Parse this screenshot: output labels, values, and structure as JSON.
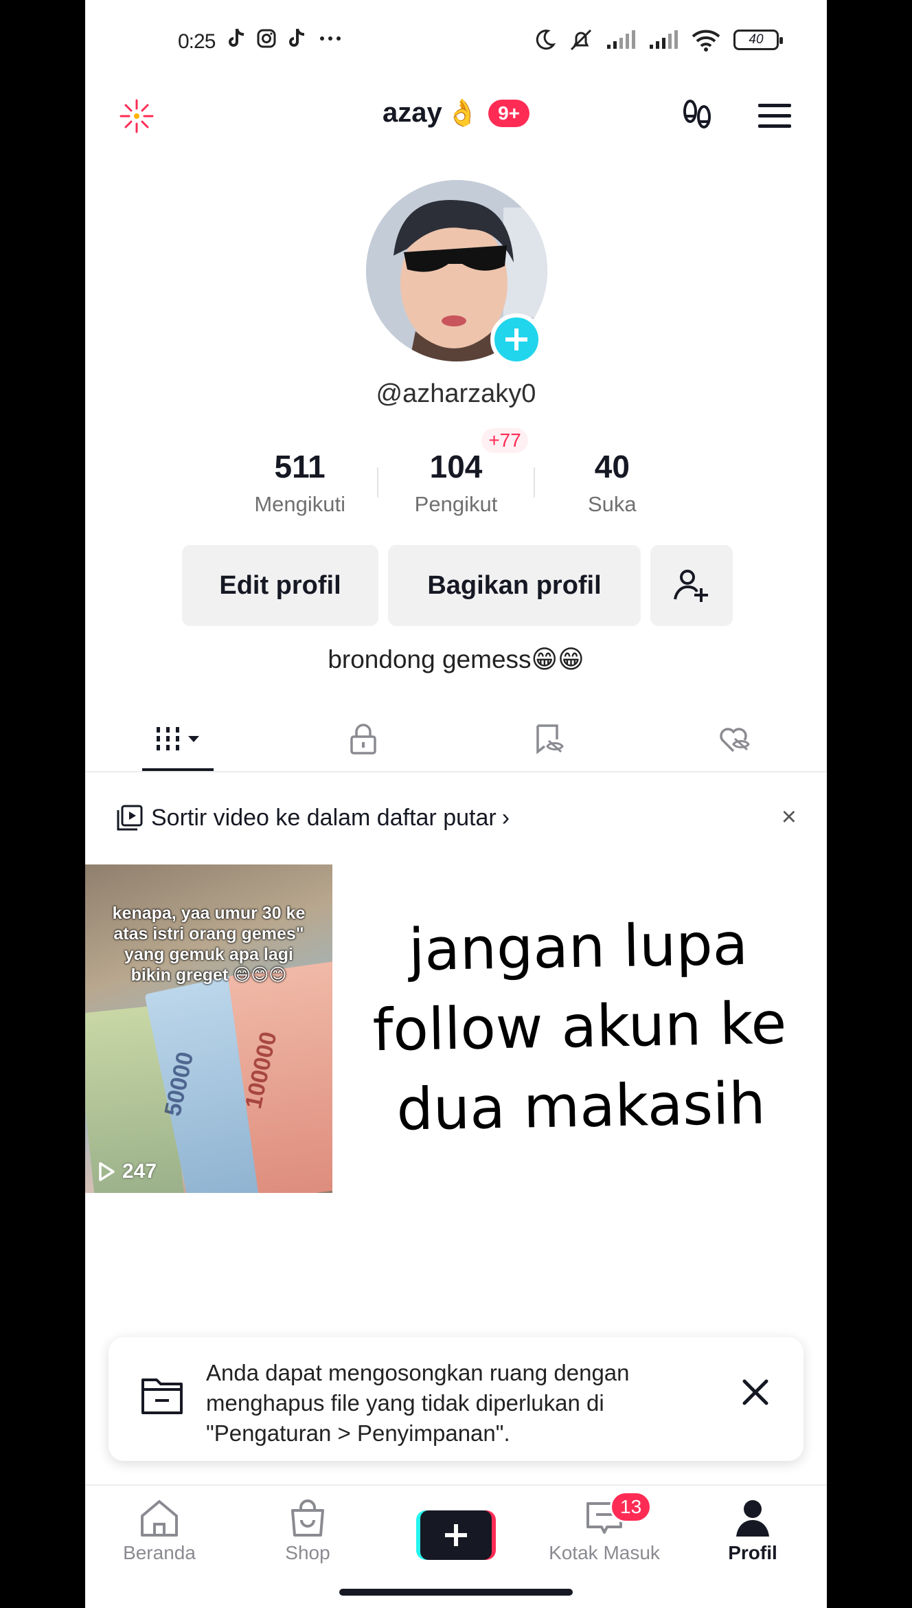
{
  "status_bar": {
    "time": "0:25",
    "battery": "40"
  },
  "header": {
    "username": "azay",
    "username_emoji": "👌",
    "notif_badge": "9+"
  },
  "profile": {
    "handle": "@azharzaky0",
    "stats": [
      {
        "value": "511",
        "label": "Mengikuti"
      },
      {
        "value": "104",
        "label": "Pengikut",
        "badge": "+77"
      },
      {
        "value": "40",
        "label": "Suka"
      }
    ],
    "buttons": {
      "edit": "Edit profil",
      "share": "Bagikan profil"
    },
    "bio": "brondong gemess😁😁"
  },
  "tabs": [
    {
      "icon": "grid-icon",
      "active": true
    },
    {
      "icon": "lock-icon"
    },
    {
      "icon": "repost-icon"
    },
    {
      "icon": "liked-hidden-icon"
    }
  ],
  "sort_banner": {
    "text": "Sortir video ke dalam daftar putar",
    "chevron": "›",
    "close": "×"
  },
  "videos": [
    {
      "caption": "kenapa, yaa umur 30 ke atas istri orang gemes\" yang gemuk apa lagi bikin greget 😄😊😊",
      "plays": "247",
      "bill_labels": [
        "50000",
        "100000"
      ]
    }
  ],
  "promo_text": "jangan lupa follow akun ke dua makasih",
  "toast": {
    "message": "Anda dapat mengosongkan ruang dengan menghapus file yang tidak diperlukan di \"Pengaturan > Penyimpanan\"."
  },
  "nav": {
    "items": [
      {
        "label": "Beranda",
        "icon": "home-icon"
      },
      {
        "label": "Shop",
        "icon": "shop-bag-icon"
      },
      {
        "label": "",
        "icon": "create-plus-icon"
      },
      {
        "label": "Kotak Masuk",
        "icon": "inbox-icon",
        "badge": "13"
      },
      {
        "label": "Profil",
        "icon": "profile-icon",
        "active": true
      }
    ]
  },
  "colors": {
    "accent": "#fe2c55",
    "cyan": "#20d5ec",
    "text": "#161823",
    "muted": "#8a8b91"
  }
}
